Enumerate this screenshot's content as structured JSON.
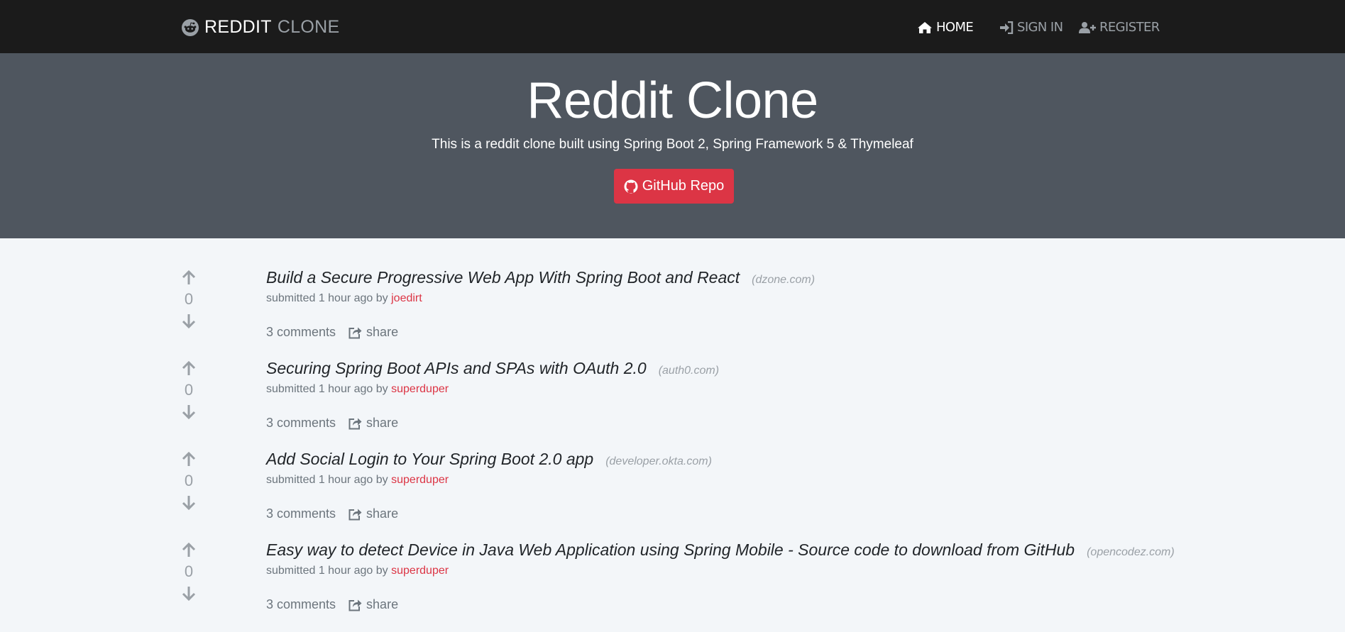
{
  "brand": {
    "part1": "REDDIT",
    "part2": "CLONE",
    "icon": "reddit-icon"
  },
  "nav": [
    {
      "label": "HOME",
      "icon": "home-icon",
      "active": true
    },
    {
      "label": "SIGN IN",
      "icon": "sign-in-icon",
      "active": false
    },
    {
      "label": "REGISTER",
      "icon": "user-plus-icon",
      "active": false
    }
  ],
  "hero": {
    "title": "Reddit Clone",
    "subtitle": "This is a reddit clone built using Spring Boot 2, Spring Framework 5 & Thymeleaf",
    "button_label": "GitHub Repo",
    "button_icon": "github-icon"
  },
  "colors": {
    "accent": "#dc3545",
    "navbar": "#1b1b1b",
    "hero": "#4f565f",
    "page": "#f3f6f9"
  },
  "posts": [
    {
      "score": "0",
      "title": "Build a Secure Progressive Web App With Spring Boot and React",
      "domain": "(dzone.com)",
      "submitted": "submitted 1 hour ago by",
      "author": "joedirt",
      "comments": "3 comments",
      "share": "share"
    },
    {
      "score": "0",
      "title": "Securing Spring Boot APIs and SPAs with OAuth 2.0",
      "domain": "(auth0.com)",
      "submitted": "submitted 1 hour ago by",
      "author": "superduper",
      "comments": "3 comments",
      "share": "share"
    },
    {
      "score": "0",
      "title": "Add Social Login to Your Spring Boot 2.0 app",
      "domain": "(developer.okta.com)",
      "submitted": "submitted 1 hour ago by",
      "author": "superduper",
      "comments": "3 comments",
      "share": "share"
    },
    {
      "score": "0",
      "title": "Easy way to detect Device in Java Web Application using Spring Mobile - Source code to download from GitHub",
      "domain": "(opencodez.com)",
      "submitted": "submitted 1 hour ago by",
      "author": "superduper",
      "comments": "3 comments",
      "share": "share"
    }
  ]
}
